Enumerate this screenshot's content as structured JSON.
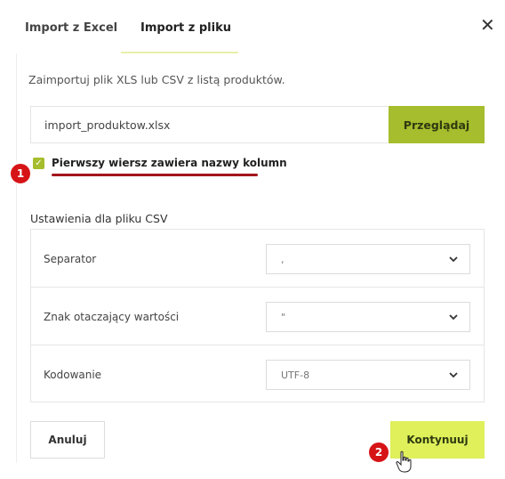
{
  "tabs": [
    {
      "label": "Import z Excel"
    },
    {
      "label": "Import z pliku"
    }
  ],
  "intro_text": "Zaimportuj plik XLS lub CSV z listą produktów.",
  "file": {
    "value": "import_produktow.xlsx",
    "browse_label": "Przeglądaj"
  },
  "checkbox": {
    "label": "Pierwszy wiersz zawiera nazwy kolumn",
    "checked": true
  },
  "csv": {
    "title": "Ustawienia dla pliku CSV",
    "rows": [
      {
        "label": "Separator",
        "value": ","
      },
      {
        "label": "Znak otaczający wartości",
        "value": "\""
      },
      {
        "label": "Kodowanie",
        "value": "UTF-8"
      }
    ]
  },
  "buttons": {
    "cancel": "Anuluj",
    "continue": "Kontynuuj"
  },
  "badges": [
    "1",
    "2"
  ],
  "colors": {
    "accent": "#a6bd2d",
    "continue_bg": "#dff05a",
    "badge": "#d61417",
    "underline": "#a3161b"
  },
  "icons": {
    "close": "close-icon",
    "chevron": "chevron-down-icon",
    "cursor": "hand-cursor-icon"
  }
}
